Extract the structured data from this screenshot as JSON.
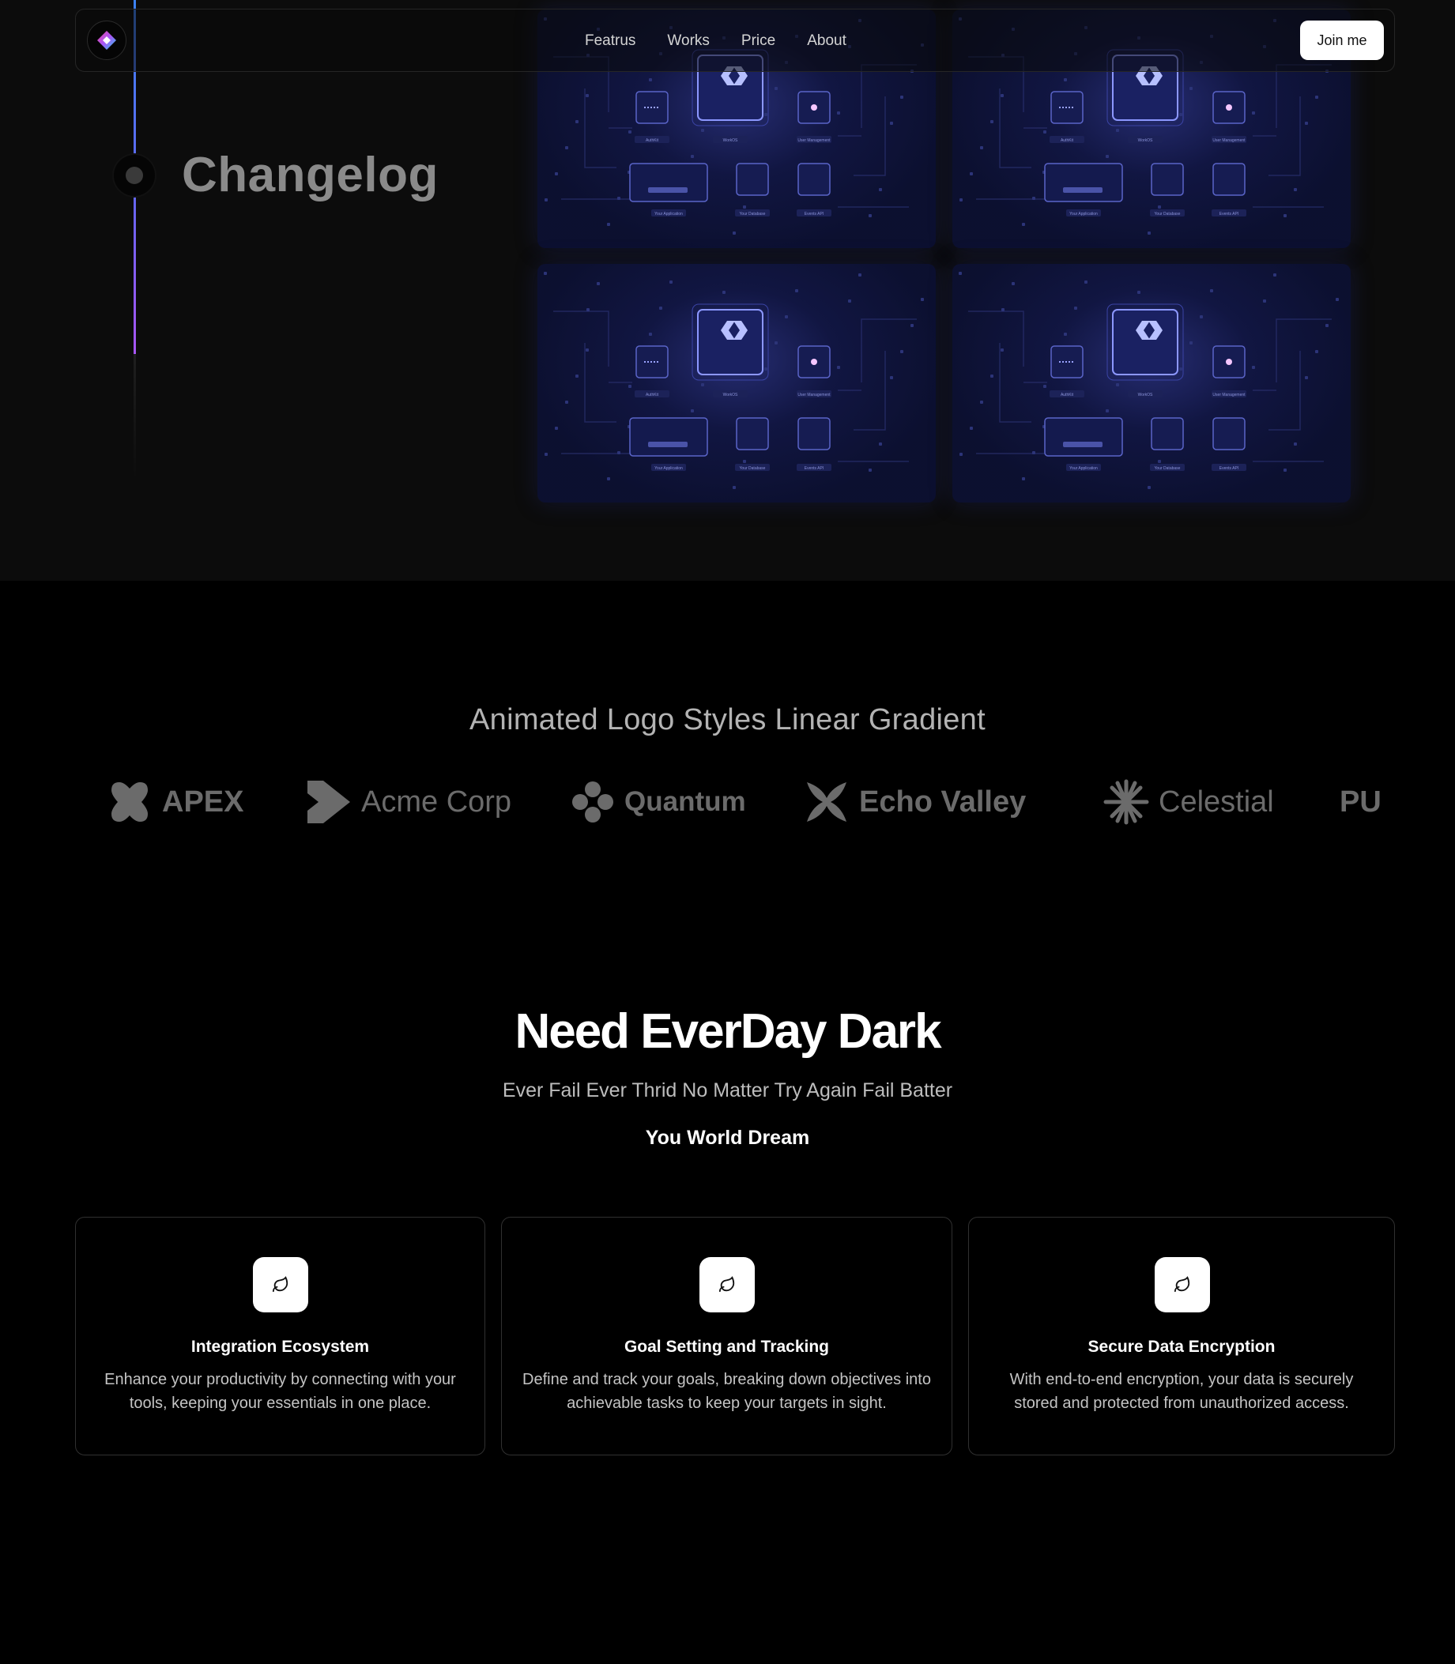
{
  "navbar": {
    "logo_icon": "diamond-gradient-logo-icon",
    "links": [
      "Featrus",
      "Works",
      "Price",
      "About"
    ],
    "cta_label": "Join me"
  },
  "changelog": {
    "title": "Changelog",
    "card_labels": {
      "top": [
        "AuthKit",
        "WorkOS",
        "User Management"
      ],
      "bottom": [
        "Your Application",
        "Your Database",
        "Events API"
      ]
    }
  },
  "logos": {
    "heading": "Animated Logo Styles Linear Gradient",
    "items": [
      {
        "name": "APEX",
        "icon": "clover-square-icon"
      },
      {
        "name": "Acme Corp",
        "icon": "double-chevron-icon"
      },
      {
        "name": "Quantum",
        "icon": "four-leaf-icon"
      },
      {
        "name": "Echo Valley",
        "icon": "x-petal-icon"
      },
      {
        "name": "Celestial",
        "icon": "asterisk-star-icon"
      },
      {
        "name": "PU",
        "icon": "partial-wordmark"
      }
    ]
  },
  "features": {
    "title": "Need EverDay Dark",
    "subtitle": "Ever Fail Ever Thrid No Matter Try Again Fail Batter",
    "tagline": "You World Dream",
    "cards": [
      {
        "icon": "leaf-icon",
        "title": "Integration Ecosystem",
        "body": "Enhance your productivity by connecting with your tools, keeping your essentials in one place."
      },
      {
        "icon": "leaf-icon",
        "title": "Goal Setting and Tracking",
        "body": "Define and track your goals, breaking down objectives into achievable tasks to keep your targets in sight."
      },
      {
        "icon": "leaf-icon",
        "title": "Secure Data Encryption",
        "body": "With end-to-end encryption, your data is securely stored and protected from unauthorized access."
      }
    ]
  },
  "colors": {
    "timeline_gradient": [
      "#3b82f6",
      "#a855f7"
    ],
    "card_glow": "#4852c8",
    "background": "#000000"
  }
}
